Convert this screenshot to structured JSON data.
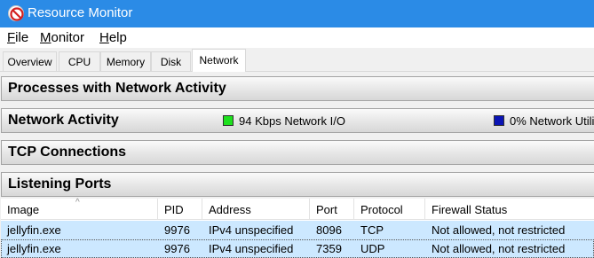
{
  "window": {
    "title": "Resource Monitor",
    "app_icon": "no-entry-icon"
  },
  "menu": [
    {
      "accel": "F",
      "rest": "ile"
    },
    {
      "accel": "M",
      "rest": "onitor"
    },
    {
      "accel": "H",
      "rest": "elp"
    }
  ],
  "tabs": [
    "Overview",
    "CPU",
    "Memory",
    "Disk",
    "Network"
  ],
  "active_tab": "Network",
  "sections": {
    "processes": {
      "title": "Processes with Network Activity"
    },
    "activity": {
      "title": "Network Activity",
      "io_label": "94 Kbps Network I/O",
      "io_color": "#1ee01e",
      "util_label": "0% Network Utili",
      "util_color": "#0a14b4"
    },
    "tcp": {
      "title": "TCP Connections"
    },
    "listening": {
      "title": "Listening Ports"
    }
  },
  "listening_ports": {
    "columns": [
      "Image",
      "PID",
      "Address",
      "Port",
      "Protocol",
      "Firewall Status"
    ],
    "rows": [
      [
        "jellyfin.exe",
        "9976",
        "IPv4 unspecified",
        "8096",
        "TCP",
        "Not allowed, not restricted"
      ],
      [
        "jellyfin.exe",
        "9976",
        "IPv4 unspecified",
        "7359",
        "UDP",
        "Not allowed, not restricted"
      ]
    ]
  }
}
